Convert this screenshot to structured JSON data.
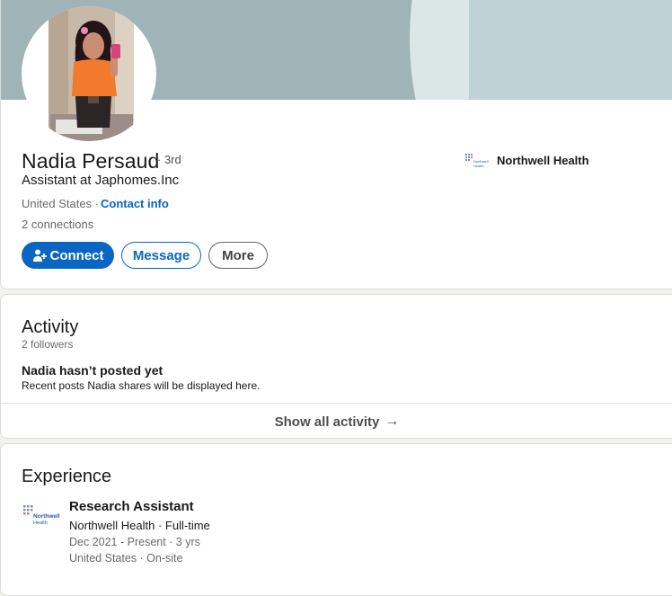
{
  "profile": {
    "name": "Nadia Persaud",
    "degree": "· 3rd",
    "headline": "Assistant at Japhomes.Inc",
    "location": "United States ·",
    "contact_info": "Contact info",
    "connections": "2 connections",
    "buttons": {
      "connect": "Connect",
      "message": "Message",
      "more": "More"
    },
    "current_company": "Northwell Health",
    "icons": {
      "avatar": "profile-photo",
      "connect": "add-person-icon",
      "company_logo": "northwell-logo"
    }
  },
  "activity": {
    "title": "Activity",
    "followers": "2 followers",
    "empty_title": "Nadia hasn’t posted yet",
    "empty_subtitle": "Recent posts Nadia shares will be displayed here.",
    "show_all": "Show all activity",
    "show_all_icon": "arrow-right-icon"
  },
  "experience": {
    "title": "Experience",
    "items": [
      {
        "role": "Research Assistant",
        "company": "Northwell Health · Full-time",
        "dates": "Dec 2021 - Present · 3 yrs",
        "location": "United States · On-site",
        "logo_text": "Northwell Health"
      }
    ]
  },
  "colors": {
    "accent": "#0a66c2",
    "banner": "#a0b4b7",
    "background": "#f3f2ef"
  }
}
